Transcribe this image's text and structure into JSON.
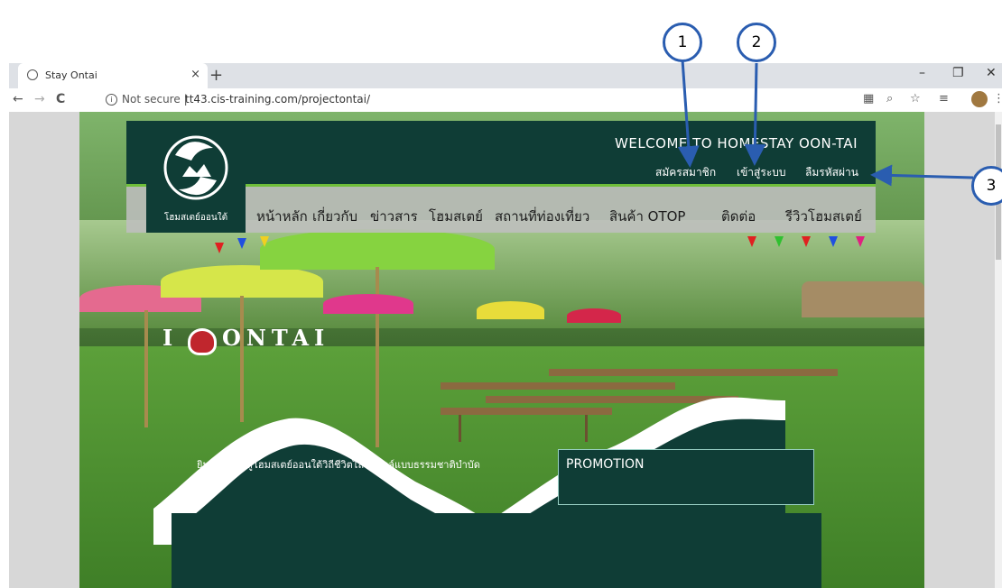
{
  "browser": {
    "tab_title": "Stay Ontai",
    "tab_close": "×",
    "new_tab": "+",
    "minimize": "–",
    "restore": "❐",
    "close": "✕",
    "back": "←",
    "forward": "→",
    "reload": "C",
    "info_glyph": "i",
    "security_label": "Not secure",
    "separator": "|",
    "url": "tt43.cis-training.com/projectontai/"
  },
  "site": {
    "welcome_heading": "WELCOME TO HOMESTAY OON-TAI",
    "logo_caption": "โฮมสเตย์ออนใต้",
    "account_links": {
      "register": "สมัครสมาชิก",
      "login": "เข้าสู่ระบบ",
      "forgot_password": "ลืมรหัสผ่าน"
    },
    "menu": [
      "หน้าหลัก",
      "เกี่ยวกับ",
      "ข่าวสาร",
      "โฮมสเตย์",
      "สถานที่ท่องเที่ยว",
      "สินค้า OTOP",
      "ติดต่อ",
      "รีวิวโฮมสเตย์"
    ],
    "hero_sign": "ONTAI",
    "hero_sign_prefix": "I",
    "welcome_text": "ยินดีต้อนรับสู่โฮมสเตย์ออนใต้วิถีชีวิตไลฟ์สไตล์แบบธรรมชาติบำบัด",
    "promotion_title": "PROMOTION"
  },
  "annotations": [
    "1",
    "2",
    "3"
  ],
  "colors": {
    "header_green": "#0f3d36",
    "accent_green": "#6fbf3a",
    "callout_blue": "#2a5db0"
  }
}
